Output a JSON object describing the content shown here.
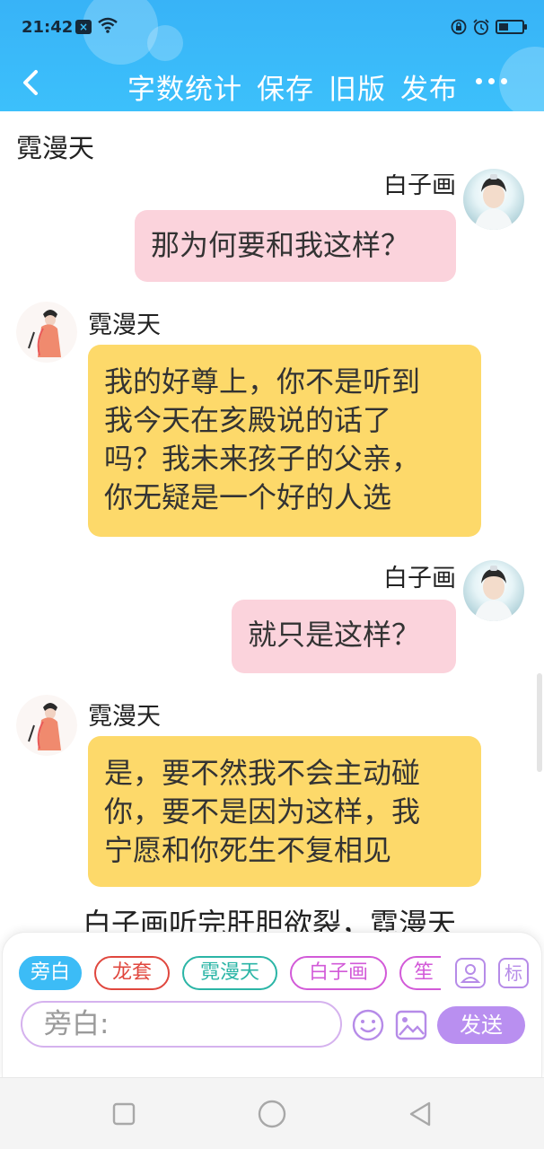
{
  "status_bar": {
    "time": "21:42"
  },
  "toolbar": {
    "word_count": "字数统计",
    "save": "保存",
    "old_version": "旧版",
    "publish": "发布"
  },
  "chat": {
    "top_name": "霓漫天",
    "messages": [
      {
        "speaker": "白子画",
        "side": "right",
        "text": "那为何要和我这样？"
      },
      {
        "speaker": "霓漫天",
        "side": "left",
        "lines": [
          "我的好尊上，你不是听到",
          "我今天在亥殿说的话了",
          "吗？我未来孩子的父亲，",
          "你无疑是一个好的人选"
        ]
      },
      {
        "speaker": "白子画",
        "side": "right",
        "text": "就只是这样？"
      },
      {
        "speaker": "霓漫天",
        "side": "left",
        "lines": [
          "是，要不然我不会主动碰",
          "你，要不是因为这样，我",
          "宁愿和你死生不复相见"
        ]
      }
    ],
    "narration_partial": "白子画听完肝胆欲裂，霓漫天"
  },
  "panel": {
    "chips": [
      {
        "label": "旁白",
        "color": "#3cbcf6"
      },
      {
        "label": "龙套",
        "color": "#e0473e"
      },
      {
        "label": "霓漫天",
        "color": "#2bb5a6"
      },
      {
        "label": "白子画",
        "color": "#d25ad8"
      },
      {
        "label": "笙",
        "color": "#d25ad8"
      }
    ],
    "person_btn_icon": "person-icon",
    "tag_btn": "标",
    "input_value": "旁白:",
    "send": "发送"
  }
}
